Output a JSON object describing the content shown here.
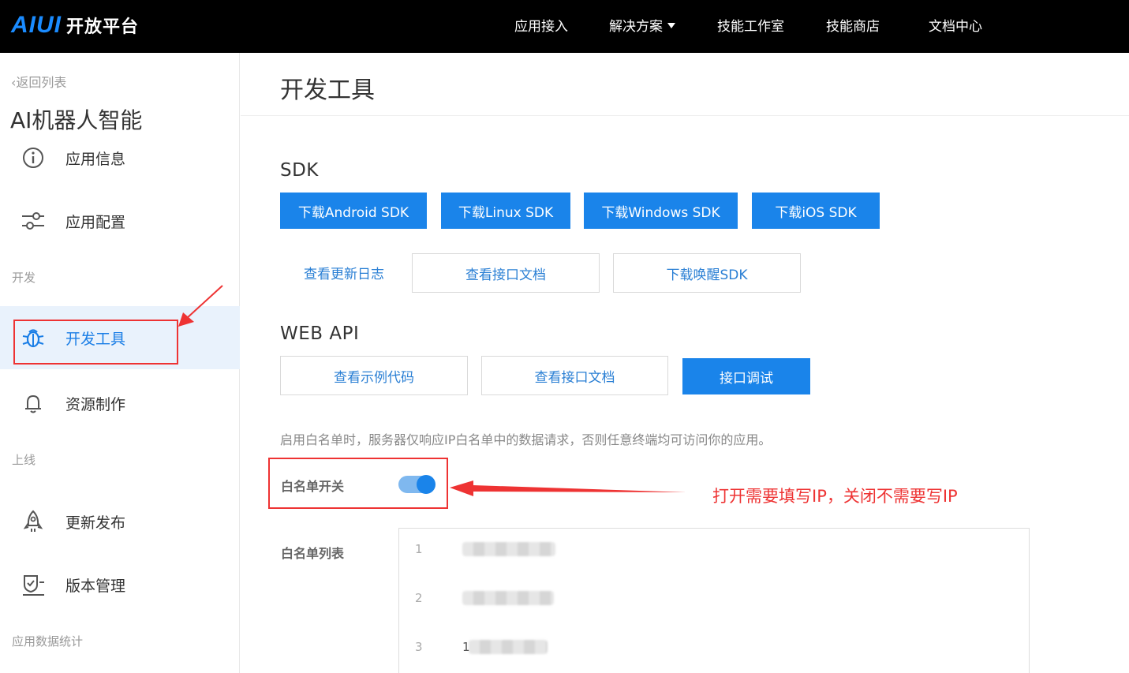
{
  "header": {
    "logo_mark": "AIUI",
    "logo_text": "开放平台",
    "nav": [
      "应用接入",
      "解决方案",
      "技能工作室",
      "技能商店",
      "文档中心"
    ]
  },
  "sidebar": {
    "back_label": "返回列表",
    "app_title": "AI机器人智能",
    "items": [
      {
        "label": "应用信息",
        "icon": "info-icon"
      },
      {
        "label": "应用配置",
        "icon": "sliders-icon"
      },
      {
        "label": "开发工具",
        "icon": "bug-icon"
      },
      {
        "label": "资源制作",
        "icon": "bell-icon"
      },
      {
        "label": "更新发布",
        "icon": "rocket-icon"
      },
      {
        "label": "版本管理",
        "icon": "shield-check-icon"
      }
    ],
    "groups": [
      "开发",
      "上线",
      "应用数据统计"
    ]
  },
  "main": {
    "page_title": "开发工具",
    "sdk": {
      "title": "SDK",
      "buttons": [
        "下载Android SDK",
        "下载Linux SDK",
        "下载Windows SDK",
        "下载iOS SDK"
      ],
      "links": [
        "查看更新日志",
        "查看接口文档",
        "下载唤醒SDK"
      ]
    },
    "webapi": {
      "title": "WEB API",
      "buttons": [
        "查看示例代码",
        "查看接口文档",
        "接口调试"
      ]
    },
    "whitelist": {
      "hint": "启用白名单时，服务器仅响应IP白名单中的数据请求，否则任意终端均可访问你的应用。",
      "switch_label": "白名单开关",
      "switch_on": true,
      "list_label": "白名单列表",
      "rows": [
        {
          "num": "1",
          "ip": ""
        },
        {
          "num": "2",
          "ip": ""
        },
        {
          "num": "3",
          "ip": "1"
        }
      ]
    },
    "annotation": "打开需要填写IP，关闭不需要写IP"
  },
  "colors": {
    "accent": "#1a84ea",
    "annotation": "#e33333",
    "topbar": "#000000"
  }
}
